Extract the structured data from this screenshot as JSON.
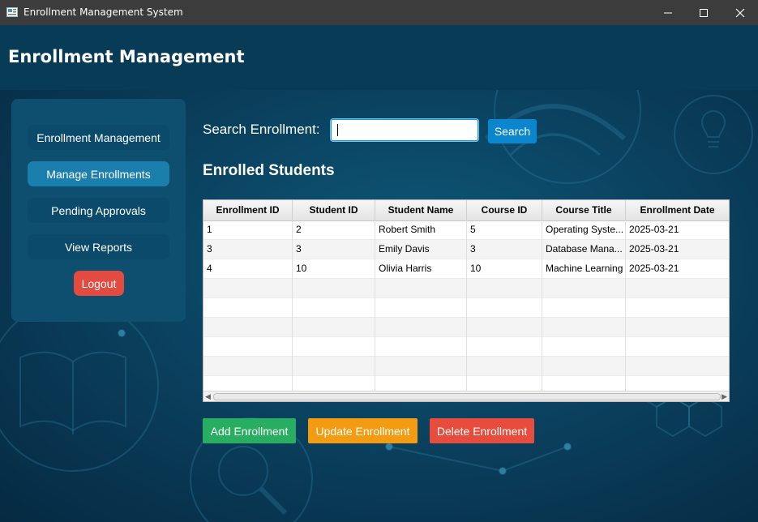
{
  "window": {
    "title": "Enrollment Management System",
    "controls": [
      "minimize-icon",
      "maximize-icon",
      "close-icon"
    ]
  },
  "header": {
    "title": "Enrollment Management"
  },
  "sidebar": {
    "items": [
      {
        "label": "Enrollment Management"
      },
      {
        "label": "Manage Enrollments",
        "active": true
      },
      {
        "label": "Pending Approvals"
      },
      {
        "label": "View Reports"
      }
    ],
    "logout_label": "Logout"
  },
  "search": {
    "label": "Search Enrollment:",
    "value": "",
    "button_label": "Search"
  },
  "section_title": "Enrolled Students",
  "table": {
    "columns": [
      "Enrollment ID",
      "Student ID",
      "Student Name",
      "Course ID",
      "Course Title",
      "Enrollment Date"
    ],
    "rows": [
      [
        "1",
        "2",
        "Robert Smith",
        "5",
        "Operating Syste...",
        "2025-03-21"
      ],
      [
        "3",
        "3",
        "Emily Davis",
        "3",
        "Database Mana...",
        "2025-03-21"
      ],
      [
        "4",
        "10",
        "Olivia Harris",
        "10",
        "Machine Learning",
        "2025-03-21"
      ]
    ]
  },
  "actions": {
    "add_label": "Add Enrollment",
    "update_label": "Update Enrollment",
    "delete_label": "Delete Enrollment"
  },
  "colors": {
    "header_bg": "#073b56",
    "sidebar_bg": "#0e4f70",
    "nav_active": "#1a7fad",
    "logout": "#e34b40",
    "search_button": "#0a86cf",
    "add": "#27ae60",
    "update": "#f39c12",
    "delete": "#e74c3c"
  }
}
